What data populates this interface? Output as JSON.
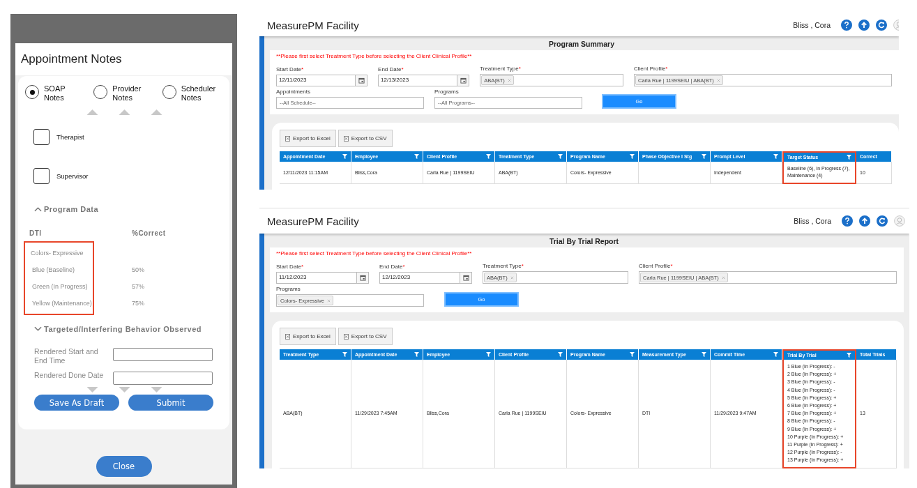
{
  "dialog": {
    "title": "Appointment Notes",
    "note_types": [
      {
        "label": "SOAP Notes",
        "selected": true
      },
      {
        "label": "Provider Notes",
        "selected": false
      },
      {
        "label": "Scheduler Notes",
        "selected": false
      }
    ],
    "signatures": [
      {
        "label": "Therapist",
        "checked": false
      },
      {
        "label": "Supervisor",
        "checked": false
      }
    ],
    "program_data": {
      "heading": "Program Data",
      "expanded": true,
      "columns": [
        "DTI",
        "%Correct"
      ],
      "program": "Colors- Expressive",
      "highlighted": true,
      "rows": [
        {
          "target": "Blue (Baseline)",
          "correct": "50%"
        },
        {
          "target": "Green (In Progress)",
          "correct": "57%"
        },
        {
          "target": "Yellow (Maintenance)",
          "correct": "75%"
        }
      ]
    },
    "behavior": {
      "heading": "Targeted/Interfering Behavior Observed",
      "expanded": false
    },
    "fields": [
      {
        "label": "Rendered Start and End Time"
      },
      {
        "label": "Rendered Done Date"
      }
    ],
    "buttons": [
      "Save As Draft",
      "Submit"
    ],
    "close": "Close"
  },
  "reports": [
    {
      "app_title": "MeasurePM Facility",
      "user": "Bliss , Cora",
      "title": "Program Summary",
      "notice": "**Please first select Treatment Type before selecting the Client Clinical Profile**",
      "form_rows": [
        [
          {
            "kind": "date",
            "label": "Start Date",
            "required_mark": "*",
            "value": "12/11/2023"
          },
          {
            "kind": "date",
            "label": "End Date",
            "required_mark": "*",
            "value": "12/13/2023"
          },
          {
            "kind": "tags",
            "label": "Treatment Type",
            "required_mark": "*",
            "tags": [
              "ABA(BT)"
            ]
          },
          {
            "kind": "client",
            "label": "Client Profile",
            "required_mark": "*",
            "tags": [
              "Carla Rue | 1199SEIU | ABA(BT)"
            ]
          }
        ],
        [
          {
            "kind": "select",
            "label": "Appointments",
            "value": "--All Schedule--"
          },
          {
            "kind": "select",
            "label": "Programs",
            "value": "--All Programs--"
          },
          {
            "kind": "go",
            "label": "Go"
          }
        ]
      ],
      "exports": [
        "Export to Excel",
        "Export to CSV"
      ],
      "table": {
        "columns": [
          {
            "label": "Appointment Date",
            "filter": true,
            "highlighted": false
          },
          {
            "label": "Employee",
            "filter": true,
            "highlighted": false
          },
          {
            "label": "Client Profile",
            "filter": true,
            "highlighted": false
          },
          {
            "label": "Treatment Type",
            "filter": true,
            "highlighted": false
          },
          {
            "label": "Program Name",
            "filter": true,
            "highlighted": false
          },
          {
            "label": "Phase Objective I Stg",
            "filter": true,
            "highlighted": false
          },
          {
            "label": "Prompt Level",
            "filter": true,
            "highlighted": false
          },
          {
            "label": "Target Status",
            "filter": true,
            "highlighted": true
          },
          {
            "label": "Correct",
            "filter": false,
            "highlighted": false
          }
        ],
        "rows": [
          [
            "12/11/2023 11:15AM",
            "Bliss,Cora",
            "Carla Rue | 1199SEIU",
            "ABA(BT)",
            "Colors- Expressive",
            null,
            "Independent",
            "Baseline (6), In Progress (7), Maintenance (4)",
            "10"
          ]
        ]
      }
    },
    {
      "app_title": "MeasurePM Facility",
      "user": "Bliss , Cora",
      "title": "Trial By Trial Report",
      "notice": "**Please first select Treatment Type before selecting the Client Clinical Profile**",
      "form_rows": [
        [
          {
            "kind": "date",
            "label": "Start Date",
            "required_mark": "*",
            "value": "11/12/2023"
          },
          {
            "kind": "date",
            "label": "End Date",
            "required_mark": "*",
            "value": "12/12/2023"
          },
          {
            "kind": "tags",
            "label": "Treatment Type",
            "required_mark": "*",
            "tags": [
              "ABA(BT)"
            ]
          },
          {
            "kind": "client",
            "label": "Client Profile",
            "required_mark": "*",
            "tags": [
              "Carla Rue | 1199SEIU | ABA(BT)"
            ]
          }
        ],
        [
          {
            "kind": "tags",
            "label": "Programs",
            "tags": [
              "Colors- Expressive"
            ]
          },
          {
            "kind": "go",
            "label": "Go"
          }
        ]
      ],
      "exports": [
        "Export to Excel",
        "Export to CSV"
      ],
      "table": {
        "columns": [
          {
            "label": "Treatment Type",
            "filter": true,
            "highlighted": false
          },
          {
            "label": "Appointment Date",
            "filter": true,
            "highlighted": false
          },
          {
            "label": "Employee",
            "filter": true,
            "highlighted": false
          },
          {
            "label": "Client Profile",
            "filter": true,
            "highlighted": false
          },
          {
            "label": "Program Name",
            "filter": true,
            "highlighted": false
          },
          {
            "label": "Measurement Type",
            "filter": true,
            "highlighted": false
          },
          {
            "label": "Commit Time",
            "filter": true,
            "highlighted": false
          },
          {
            "label": "Trial By Trial",
            "filter": true,
            "highlighted": true
          },
          {
            "label": "Total Trials",
            "filter": false,
            "highlighted": false
          }
        ],
        "rows": [
          [
            "ABA(BT)",
            "11/29/2023 7:45AM",
            "Bliss,Cora",
            "Carla Rue | 1199SEIU",
            "Colors- Expressive",
            "DTI",
            "11/29/2023 9:47AM",
            [
              "1 Blue (In Progress): -",
              "2 Blue (In Progress): +",
              "3 Blue (In Progress): -",
              "4 Blue (In Progress): -",
              "5 Blue (In Progress): +",
              "6 Blue (In Progress): +",
              "7 Blue (In Progress): +",
              "8 Blue (In Progress): -",
              "9 Blue (In Progress): +",
              "10 Purple (In Progress): +",
              "11 Purple (In Progress): +",
              "12 Purple (In Progress): -",
              "13 Purple (In Progress): +"
            ],
            "13"
          ]
        ]
      }
    }
  ]
}
